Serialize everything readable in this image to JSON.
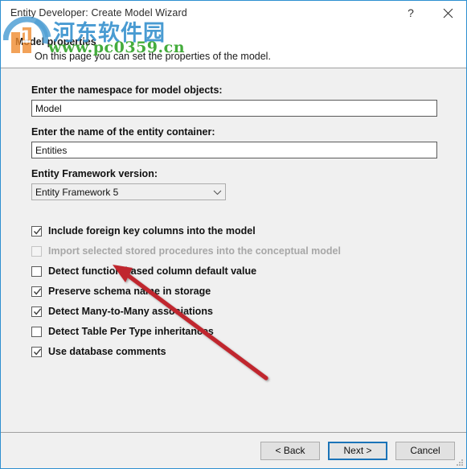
{
  "window": {
    "title": "Entity Developer: Create Model Wizard",
    "help_icon": "question-mark-icon",
    "help_label": "?",
    "close_icon": "close-icon"
  },
  "header": {
    "title": "Model properties",
    "subtitle": "On this page you can set the properties of the model."
  },
  "form": {
    "namespace": {
      "label": "Enter the namespace for model objects:",
      "value": "Model",
      "placeholder": ""
    },
    "container": {
      "label": "Enter the name of the entity container:",
      "value": "Entities",
      "placeholder": ""
    },
    "framework": {
      "label": "Entity Framework version:",
      "value": "Entity Framework 5"
    }
  },
  "options": [
    {
      "label": "Include foreign key columns into the model",
      "checked": true,
      "enabled": true
    },
    {
      "label": "Import selected stored procedures into the conceptual model",
      "checked": false,
      "enabled": false
    },
    {
      "label": "Detect function-based column default value",
      "checked": false,
      "enabled": true
    },
    {
      "label": "Preserve schema name in storage",
      "checked": true,
      "enabled": true
    },
    {
      "label": "Detect Many-to-Many associations",
      "checked": true,
      "enabled": true
    },
    {
      "label": "Detect Table Per Type inheritances",
      "checked": false,
      "enabled": true
    },
    {
      "label": "Use database comments",
      "checked": true,
      "enabled": true
    }
  ],
  "footer": {
    "back_label": "< Back",
    "next_label": "Next >",
    "cancel_label": "Cancel"
  },
  "watermark": {
    "site_name": "河东软件园",
    "site_url": "www.pc0359.cn",
    "logo": "pc0359-logo-icon"
  },
  "colors": {
    "accent": "#1b74b8",
    "window_border": "#2e8fd0",
    "body_bg": "#f0f0f0",
    "header_bg": "#ffffff",
    "annotation": "#c0272d",
    "watermark_blue": "#3a93cf",
    "watermark_green": "#3aa832"
  }
}
